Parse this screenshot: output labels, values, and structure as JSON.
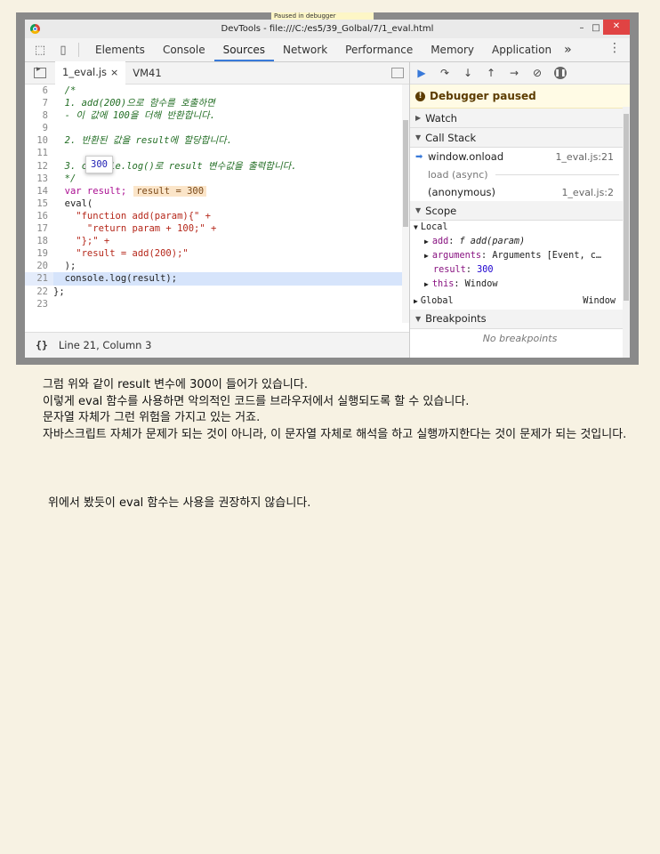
{
  "window": {
    "title": "DevTools - file:///C:/es5/39_Golbal/7/1_eval.html",
    "paused_badge": "Paused in debugger"
  },
  "devtools_tabs": [
    "Elements",
    "Console",
    "Sources",
    "Network",
    "Performance",
    "Memory",
    "Application"
  ],
  "active_tab": "Sources",
  "more_tabs": "»",
  "file_tabs": [
    {
      "label": "1_eval.js",
      "close": "×"
    },
    {
      "label": "VM41"
    }
  ],
  "code": {
    "lines": [
      {
        "n": "6",
        "t": "  /*"
      },
      {
        "n": "7",
        "t": "  1. add(200)으로 함수를 호출하면"
      },
      {
        "n": "8",
        "t": "  - 이 값에 100을 더해 반환합니다."
      },
      {
        "n": "9",
        "t": ""
      },
      {
        "n": "10",
        "t": "  2. 반환된 값을 result에 할당합니다."
      },
      {
        "n": "11",
        "t": ""
      },
      {
        "n": "12",
        "t": "  3. console.log()로 result 변수값을 출력합니다."
      },
      {
        "n": "13",
        "t": "  */"
      },
      {
        "n": "14",
        "t": "  var result;"
      },
      {
        "n": "15",
        "t": "  eval("
      },
      {
        "n": "16",
        "t": "    \"function add(param){\" +"
      },
      {
        "n": "17",
        "t": "      \"return param + 100;\" +"
      },
      {
        "n": "18",
        "t": "    \"};\" +"
      },
      {
        "n": "19",
        "t": "    \"result = add(200);\""
      },
      {
        "n": "20",
        "t": "  );"
      },
      {
        "n": "21",
        "t": "  console.log(result);"
      },
      {
        "n": "22",
        "t": "};"
      },
      {
        "n": "23",
        "t": ""
      }
    ],
    "inline_value": "result = 300",
    "hover_popup": "300"
  },
  "status": {
    "braces": "{}",
    "position": "Line 21, Column 3"
  },
  "debugger": {
    "banner": "Debugger paused",
    "watch": "Watch",
    "call_stack": "Call Stack",
    "frames": [
      {
        "name": "window.onload",
        "loc": "1_eval.js:21"
      },
      {
        "name": "(anonymous)",
        "loc": "1_eval.js:2"
      }
    ],
    "async_label": "load (async)",
    "scope": "Scope",
    "local": "Local",
    "scope_items": [
      {
        "key": "add",
        "value": "f add(param)"
      },
      {
        "key": "arguments",
        "value": "Arguments [Event, c…"
      },
      {
        "key": "result",
        "value": "300"
      },
      {
        "key": "this",
        "value": "Window"
      }
    ],
    "global": "Global",
    "global_value": "Window",
    "breakpoints": "Breakpoints",
    "no_breakpoints": "No breakpoints"
  },
  "body_text": [
    "그럼 위와 같이 result 변수에 300이 들어가 있습니다.",
    "이렇게 eval 함수를 사용하면 악의적인 코드를 브라우저에서 실행되도록 할 수 있습니다.",
    "문자열 자체가 그런 위험을 가지고 있는 거죠.",
    "자바스크립트 자체가 문제가 되는 것이 아니라, 이 문자열 자체로 해석을 하고 실행까지한다는 것이 문제가 되는 것입니다."
  ],
  "closing_text": "위에서 봤듯이 eval 함수는 사용을 권장하지 않습니다."
}
